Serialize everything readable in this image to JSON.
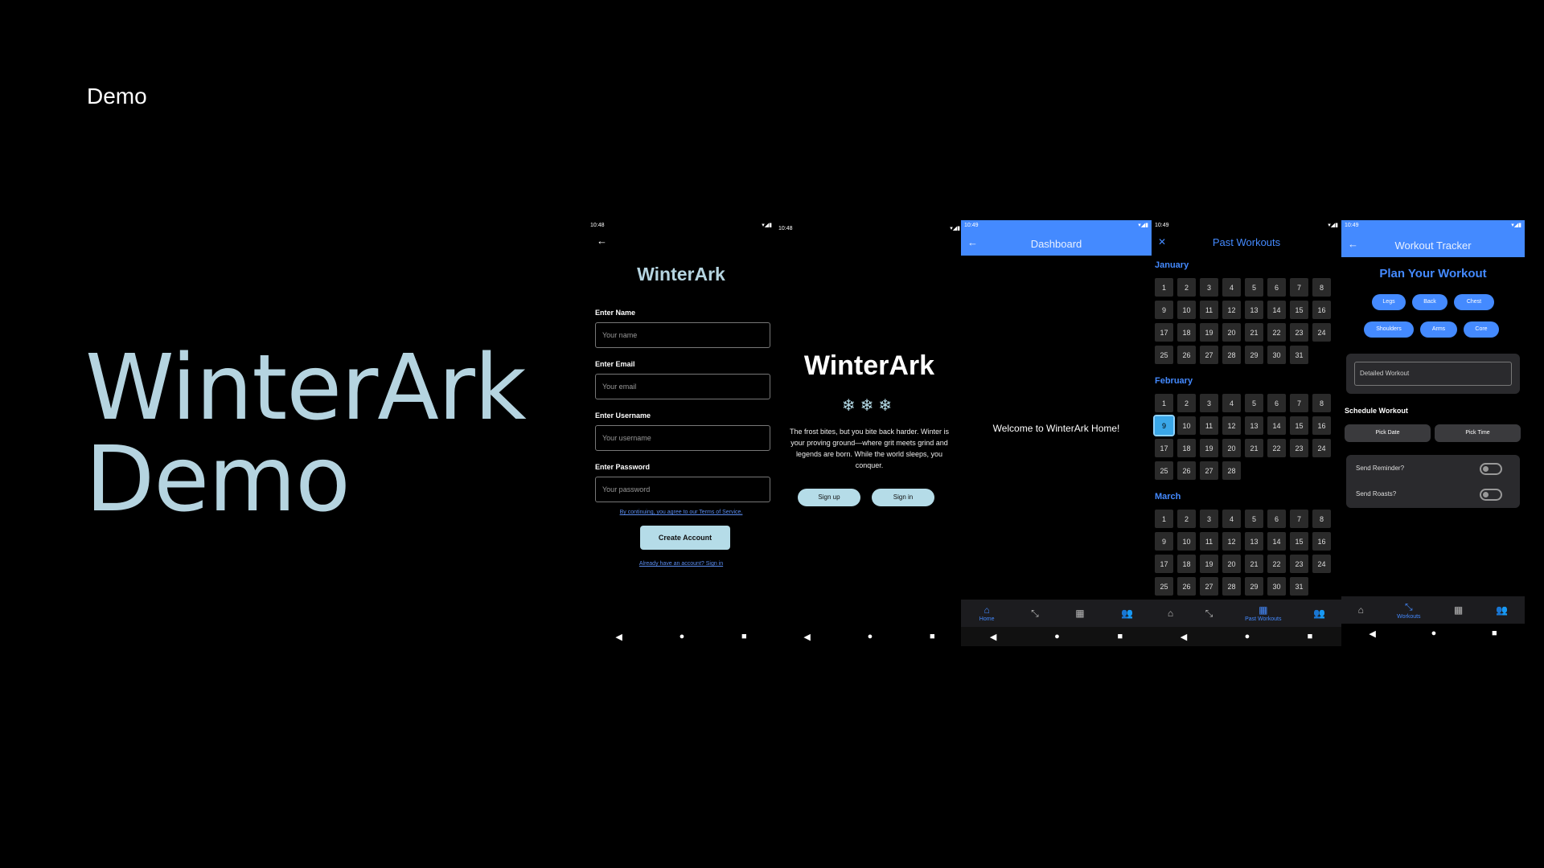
{
  "slide": {
    "label": "Demo",
    "title_line1": "WinterArk",
    "title_line2": "Demo"
  },
  "nav_buttons": {
    "back": "◀",
    "home": "●",
    "recents": "■"
  },
  "phone1": {
    "status_time": "10:48",
    "back_icon": "←",
    "title": "WinterArk",
    "fields": [
      {
        "label": "Enter Name",
        "placeholder": "Your name"
      },
      {
        "label": "Enter Email",
        "placeholder": "Your email"
      },
      {
        "label": "Enter Username",
        "placeholder": "Your username"
      },
      {
        "label": "Enter Password",
        "placeholder": "Your password"
      }
    ],
    "terms": "By continuing, you agree to our Terms of Service.",
    "create_button": "Create Account",
    "signin_link": "Already have an account? Sign in"
  },
  "phone2": {
    "status_time": "10:48",
    "title": "WinterArk",
    "flakes": "❄❄❄",
    "text": "The frost bites, but you bite back harder. Winter is your proving ground—where grit meets grind and legends are born. While the world sleeps, you conquer.",
    "signup_button": "Sign up",
    "signin_button": "Sign in"
  },
  "phone3": {
    "status_time": "10:49",
    "bar_title": "Dashboard",
    "welcome": "Welcome to WinterArk Home!",
    "tab_home": "Home"
  },
  "phone4": {
    "status_time": "10:49",
    "bar_title": "Past Workouts",
    "months": [
      {
        "name": "January",
        "days": [
          "1",
          "2",
          "3",
          "4",
          "5",
          "6",
          "7",
          "8",
          "9",
          "10",
          "11",
          "12",
          "13",
          "14",
          "15",
          "16",
          "17",
          "18",
          "19",
          "20",
          "21",
          "22",
          "23",
          "24",
          "25",
          "26",
          "27",
          "28",
          "29",
          "30",
          "31"
        ]
      },
      {
        "name": "February",
        "days": [
          "1",
          "2",
          "3",
          "4",
          "5",
          "6",
          "7",
          "8",
          "9",
          "10",
          "11",
          "12",
          "13",
          "14",
          "15",
          "16",
          "17",
          "18",
          "19",
          "20",
          "21",
          "22",
          "23",
          "24",
          "25",
          "26",
          "27",
          "28"
        ]
      },
      {
        "name": "March",
        "days": [
          "1",
          "2",
          "3",
          "4",
          "5",
          "6",
          "7",
          "8",
          "9",
          "10",
          "11",
          "12",
          "13",
          "14",
          "15",
          "16",
          "17",
          "18",
          "19",
          "20",
          "21",
          "22",
          "23",
          "24",
          "25",
          "26",
          "27",
          "28",
          "29",
          "30",
          "31"
        ]
      }
    ],
    "selected_month": "February",
    "selected_day": "9",
    "tab_label": "Past Workouts"
  },
  "phone5": {
    "status_time": "10:49",
    "bar_title": "Workout Tracker",
    "heading": "Plan Your Workout",
    "chips": [
      "Legs",
      "Back",
      "Chest",
      "Shoulders",
      "Arms",
      "Core"
    ],
    "detail_placeholder": "Detailed Workout",
    "schedule_label": "Schedule Workout",
    "pick_date": "Pick Date",
    "pick_time": "Pick Time",
    "reminder_label": "Send Reminder?",
    "roasts_label": "Send Roasts?",
    "tab_label": "Workouts"
  },
  "colors": {
    "accent_blue": "#448aff",
    "ice": "#b5dce8",
    "title_ice": "#b5d4e0"
  }
}
